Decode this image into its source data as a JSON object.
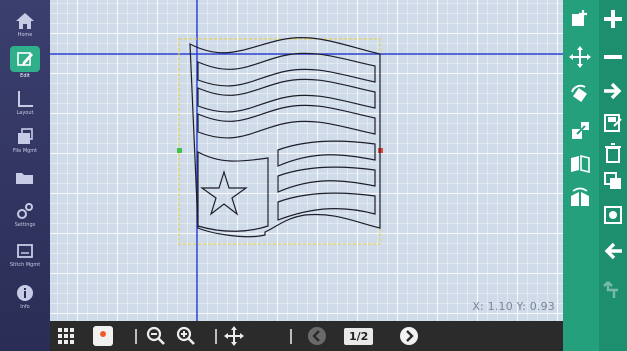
{
  "left_sidebar": {
    "items": [
      {
        "name": "home",
        "label": "Home"
      },
      {
        "name": "edit",
        "label": "Edit"
      },
      {
        "name": "layout",
        "label": "Layout"
      },
      {
        "name": "file",
        "label": "File Mgmt"
      },
      {
        "name": "open",
        "label": ""
      },
      {
        "name": "settings",
        "label": "Settings"
      },
      {
        "name": "stitch",
        "label": "Stitch Mgmt"
      },
      {
        "name": "info",
        "label": "Info"
      }
    ]
  },
  "canvas": {
    "coordinates": "X: 1.10 Y: 0.93"
  },
  "bottom_toolbar": {
    "page_indicator": "1/2"
  },
  "colors": {
    "left_bar": "#2a2d55",
    "right_bar": "#25a07c",
    "active_item": "#2fb08a",
    "guide_line": "#2a3fd0",
    "selection_box": "#e8d23a"
  }
}
